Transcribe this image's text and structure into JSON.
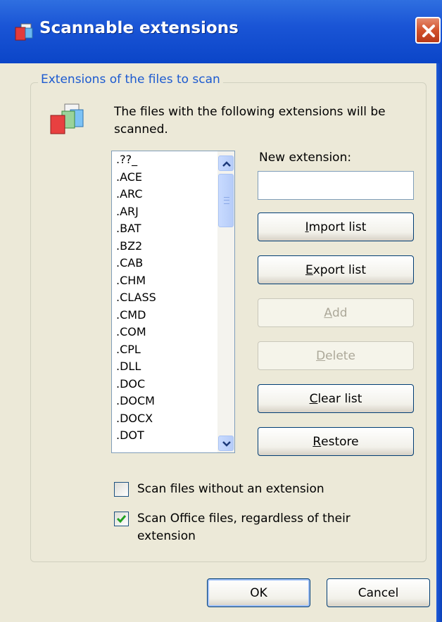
{
  "window": {
    "title": "Scannable extensions",
    "close_icon": "close-icon"
  },
  "group": {
    "legend": "Extensions of the files to scan",
    "description": "The files with the following extensions will be scanned."
  },
  "extensions": {
    "items": [
      ".??_",
      ".ACE",
      ".ARC",
      ".ARJ",
      ".BAT",
      ".BZ2",
      ".CAB",
      ".CHM",
      ".CLASS",
      ".CMD",
      ".COM",
      ".CPL",
      ".DLL",
      ".DOC",
      ".DOCM",
      ".DOCX",
      ".DOT"
    ]
  },
  "new_extension": {
    "label": "New extension:",
    "value": ""
  },
  "buttons": {
    "import": {
      "mnemonic": "I",
      "rest": "mport list"
    },
    "export": {
      "mnemonic": "E",
      "rest": "xport list"
    },
    "add": {
      "mnemonic": "A",
      "rest": "dd",
      "disabled": true
    },
    "delete": {
      "mnemonic": "D",
      "rest": "elete",
      "disabled": true
    },
    "clear": {
      "mnemonic": "C",
      "rest": "lear list"
    },
    "restore": {
      "mnemonic": "R",
      "rest": "estore"
    }
  },
  "options": {
    "no_extension": {
      "label": "Scan files without an extension",
      "checked": false
    },
    "office": {
      "label": "Scan Office files, regardless of their extension",
      "checked": true
    }
  },
  "footer": {
    "ok": "OK",
    "cancel": "Cancel"
  },
  "colors": {
    "titlebar": "#0b45c8",
    "legend": "#1c5ad0",
    "dialog_bg": "#ece9d8",
    "check": "#21a121"
  }
}
